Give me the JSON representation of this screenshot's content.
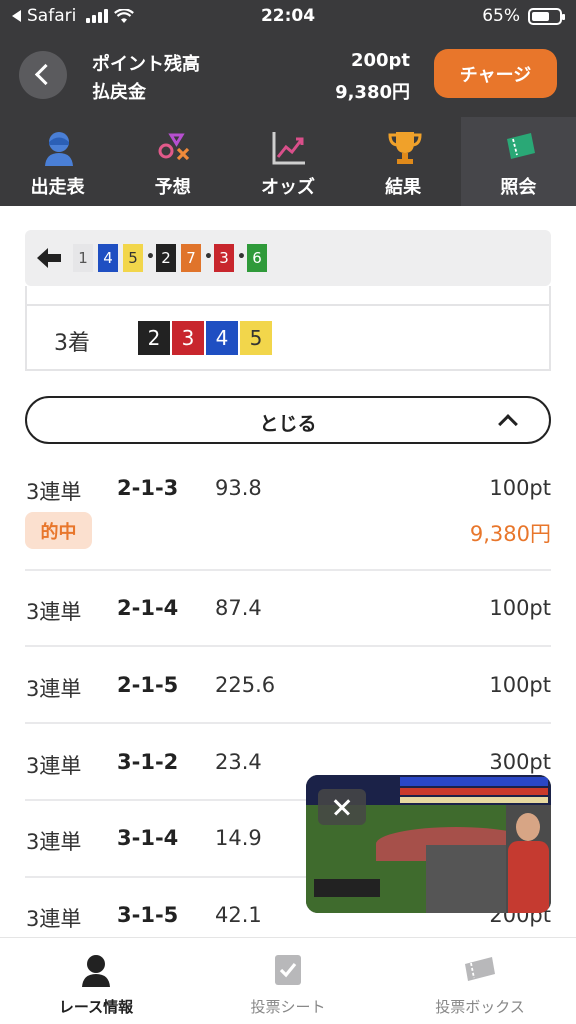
{
  "status_bar": {
    "carrier": "Safari",
    "time": "22:04",
    "battery": "65%",
    "battery_level": 0.65
  },
  "balance": {
    "points_label": "ポイント残高",
    "points_value": "200pt",
    "refund_label": "払戻金",
    "refund_value": "9,380円",
    "charge_button": "チャージ"
  },
  "nav_tabs": [
    {
      "label": "出走表",
      "icon": "racer-icon"
    },
    {
      "label": "予想",
      "icon": "prediction-icon"
    },
    {
      "label": "オッズ",
      "icon": "odds-chart-icon"
    },
    {
      "label": "結果",
      "icon": "trophy-icon"
    },
    {
      "label": "照会",
      "icon": "ticket-icon",
      "active": true
    }
  ],
  "result_order": {
    "numbers": [
      "1",
      "4",
      "5",
      "2",
      "7",
      "3",
      "6"
    ]
  },
  "third_place": {
    "label": "3着",
    "numbers": [
      "2",
      "3",
      "4",
      "5"
    ]
  },
  "close_button": "とじる",
  "bets": [
    {
      "type": "3連単",
      "combo": "2-1-3",
      "odds": "93.8",
      "amount": "100pt",
      "hit": "的中",
      "payout": "9,380円"
    },
    {
      "type": "3連単",
      "combo": "2-1-4",
      "odds": "87.4",
      "amount": "100pt"
    },
    {
      "type": "3連単",
      "combo": "2-1-5",
      "odds": "225.6",
      "amount": "100pt"
    },
    {
      "type": "3連単",
      "combo": "3-1-2",
      "odds": "23.4",
      "amount": "300pt"
    },
    {
      "type": "3連単",
      "combo": "3-1-4",
      "odds": "14.9",
      "amount": ""
    },
    {
      "type": "3連単",
      "combo": "3-1-5",
      "odds": "42.1",
      "amount": "200pt"
    }
  ],
  "bottom_tabs": [
    {
      "label": "レース情報",
      "icon": "racer-icon",
      "active": true
    },
    {
      "label": "投票シート",
      "icon": "check-sheet-icon"
    },
    {
      "label": "投票ボックス",
      "icon": "ticket-box-icon"
    }
  ],
  "colors": {
    "accent": "#e8762b",
    "header_bg": "#3a3a3c",
    "frame_1": "#f0f0f0",
    "frame_2": "#222222",
    "frame_3": "#c8262d",
    "frame_4": "#1f4fc2",
    "frame_5": "#f2d64b",
    "frame_6": "#2f9a3a",
    "frame_7": "#e0742b"
  }
}
